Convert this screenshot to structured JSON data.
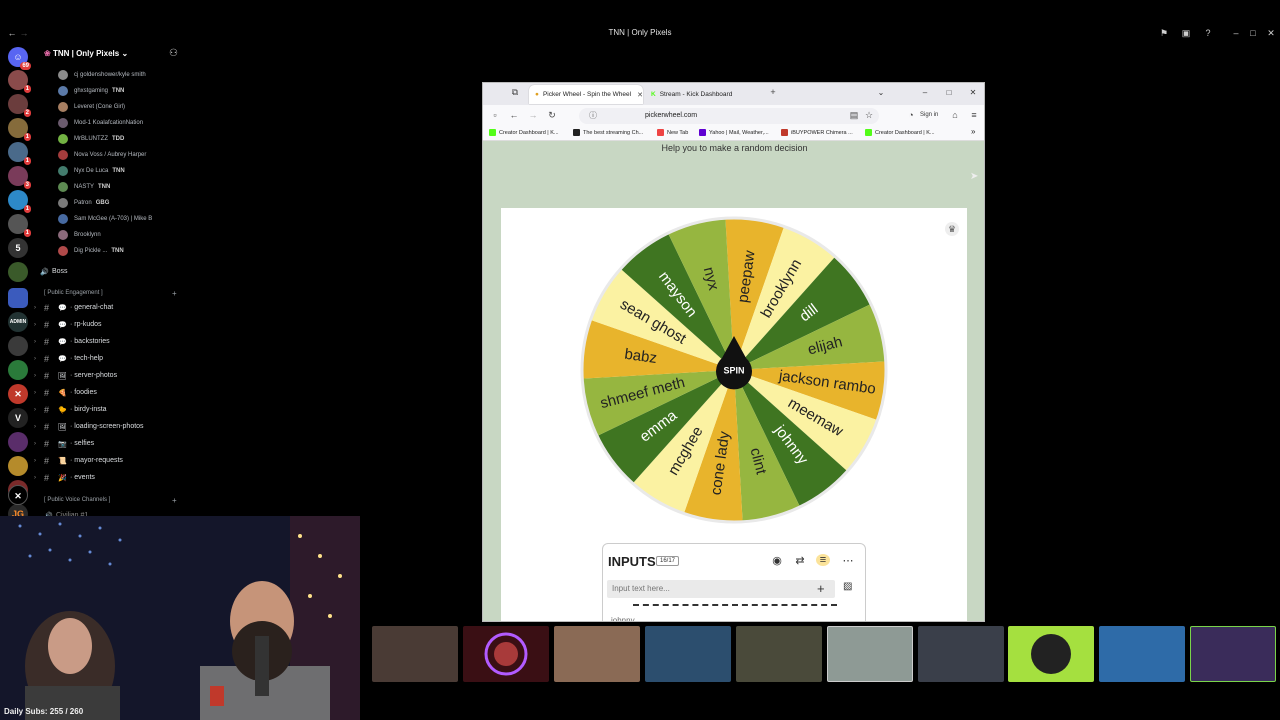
{
  "window": {
    "title": "TNN | Only Pixels"
  },
  "server": {
    "name": "TNN | Only Pixels"
  },
  "members": [
    {
      "name": "cj goldenshower/kyle smith",
      "tag": "",
      "color": "#8c8c8c"
    },
    {
      "name": "ghxstgaming",
      "tag": "TNN",
      "color": "#5b7aa8"
    },
    {
      "name": "Leveret (Cone Girl)",
      "tag": "",
      "color": "#a77f62"
    },
    {
      "name": "Mod-1 KoalafcationNation",
      "tag": "",
      "color": "#6b5b6e"
    },
    {
      "name": "MrBLUNTZZ",
      "tag": "TDD",
      "color": "#73b243"
    },
    {
      "name": "Nova Voss / Aubrey Harper",
      "tag": "",
      "color": "#a43c3c"
    },
    {
      "name": "Nyx De Luca",
      "tag": "TNN",
      "color": "#437c6d"
    },
    {
      "name": "NASTY",
      "tag": "TNN",
      "color": "#5d8a52"
    },
    {
      "name": "Patron",
      "tag": "GBG",
      "color": "#7a7a7a"
    },
    {
      "name": "Sam McGee (A-703) | Mike B",
      "tag": "",
      "color": "#476aa1"
    },
    {
      "name": "Brooklynn",
      "tag": "",
      "color": "#8c6b7c"
    },
    {
      "name": "Dig Pickle ...",
      "tag": "TNN",
      "color": "#b04a4a"
    }
  ],
  "voice_channel": {
    "name": "Boss"
  },
  "categories": {
    "public_engagement": "[ Public Engagement ]",
    "public_voice": "[ Public Voice Channels ]"
  },
  "channels": [
    {
      "name": "general-chat",
      "emoji": "💬"
    },
    {
      "name": "rp-kudos",
      "emoji": "💬"
    },
    {
      "name": "backstories",
      "emoji": "💬"
    },
    {
      "name": "tech-help",
      "emoji": "💬"
    },
    {
      "name": "server-photos",
      "emoji": "🖼"
    },
    {
      "name": "foodies",
      "emoji": "🍕"
    },
    {
      "name": "birdy-insta",
      "emoji": "🐤"
    },
    {
      "name": "loading-screen-photos",
      "emoji": "🖼"
    },
    {
      "name": "selfies",
      "emoji": "📷"
    },
    {
      "name": "mayor-requests",
      "emoji": "📜"
    },
    {
      "name": "events",
      "emoji": "🎉"
    }
  ],
  "voice_partial": "Civilian #1",
  "overlay": {
    "daily_subs": "Daily Subs: 255 / 260"
  },
  "browser": {
    "tabs": [
      {
        "label": "Picker Wheel - Spin the Wheel",
        "active": true
      },
      {
        "label": "Stream - Kick Dashboard",
        "active": false
      }
    ],
    "url": "pickerwheel.com",
    "sign_in": "Sign in",
    "bookmarks": [
      "Creator Dashboard | K...",
      "The best streaming Ch...",
      "New Tab",
      "Yahoo | Mail, Weather,...",
      "iBUYPOWER Chimera ...",
      "Creator Dashboard | K..."
    ]
  },
  "picker": {
    "tagline": "Help you to make a random decision",
    "spin_label": "SPIN",
    "inputs_title": "INPUTS",
    "inputs_count": "16/17",
    "input_placeholder": "Input text here...",
    "first_entry": "johnny",
    "entries": [
      "peepaw",
      "brooklynn",
      "dill",
      "elijah",
      "jackson rambo",
      "meemaw",
      "johnny",
      "clint",
      "cone lady",
      "mcghee",
      "emma",
      "shmeef meth",
      "babz",
      "sean ghost",
      "mayson",
      "nyx"
    ],
    "colors": [
      "#e8b42c",
      "#fbf2a2",
      "#3f7521",
      "#96b640",
      "#e8b42c",
      "#fbf2a2",
      "#3f7521",
      "#96b640"
    ]
  },
  "icons": {
    "discord": "discord-icon",
    "search": "search-icon",
    "inbox": "inbox-icon",
    "help": "help-icon"
  }
}
